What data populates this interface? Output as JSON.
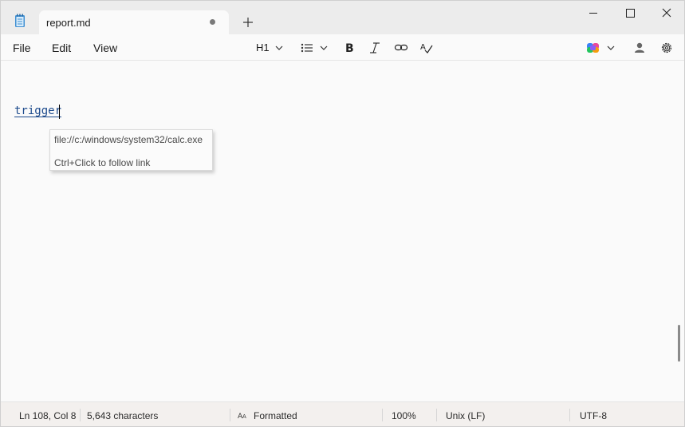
{
  "window": {
    "tab_title": "report.md"
  },
  "menu": {
    "file": "File",
    "edit": "Edit",
    "view": "View"
  },
  "toolbar": {
    "heading_level": "H1",
    "icons": [
      "heading-dropdown",
      "list-icon",
      "bold-icon",
      "italic-icon",
      "link-icon",
      "spellcheck-icon",
      "copilot-icon",
      "account-icon",
      "gear-icon"
    ]
  },
  "editor": {
    "link_text": "trigger",
    "tooltip": {
      "url": "file://c:/windows/system32/calc.exe",
      "hint": "Ctrl+Click to follow link"
    }
  },
  "status": {
    "position": "Ln 108, Col 8",
    "characters": "5,643 characters",
    "mode": "Formatted",
    "zoom": "100%",
    "line_ending": "Unix (LF)",
    "encoding": "UTF-8"
  },
  "colors": {
    "link": "#1c4a8c",
    "titlebar": "#ececec",
    "background": "#fafafa"
  }
}
